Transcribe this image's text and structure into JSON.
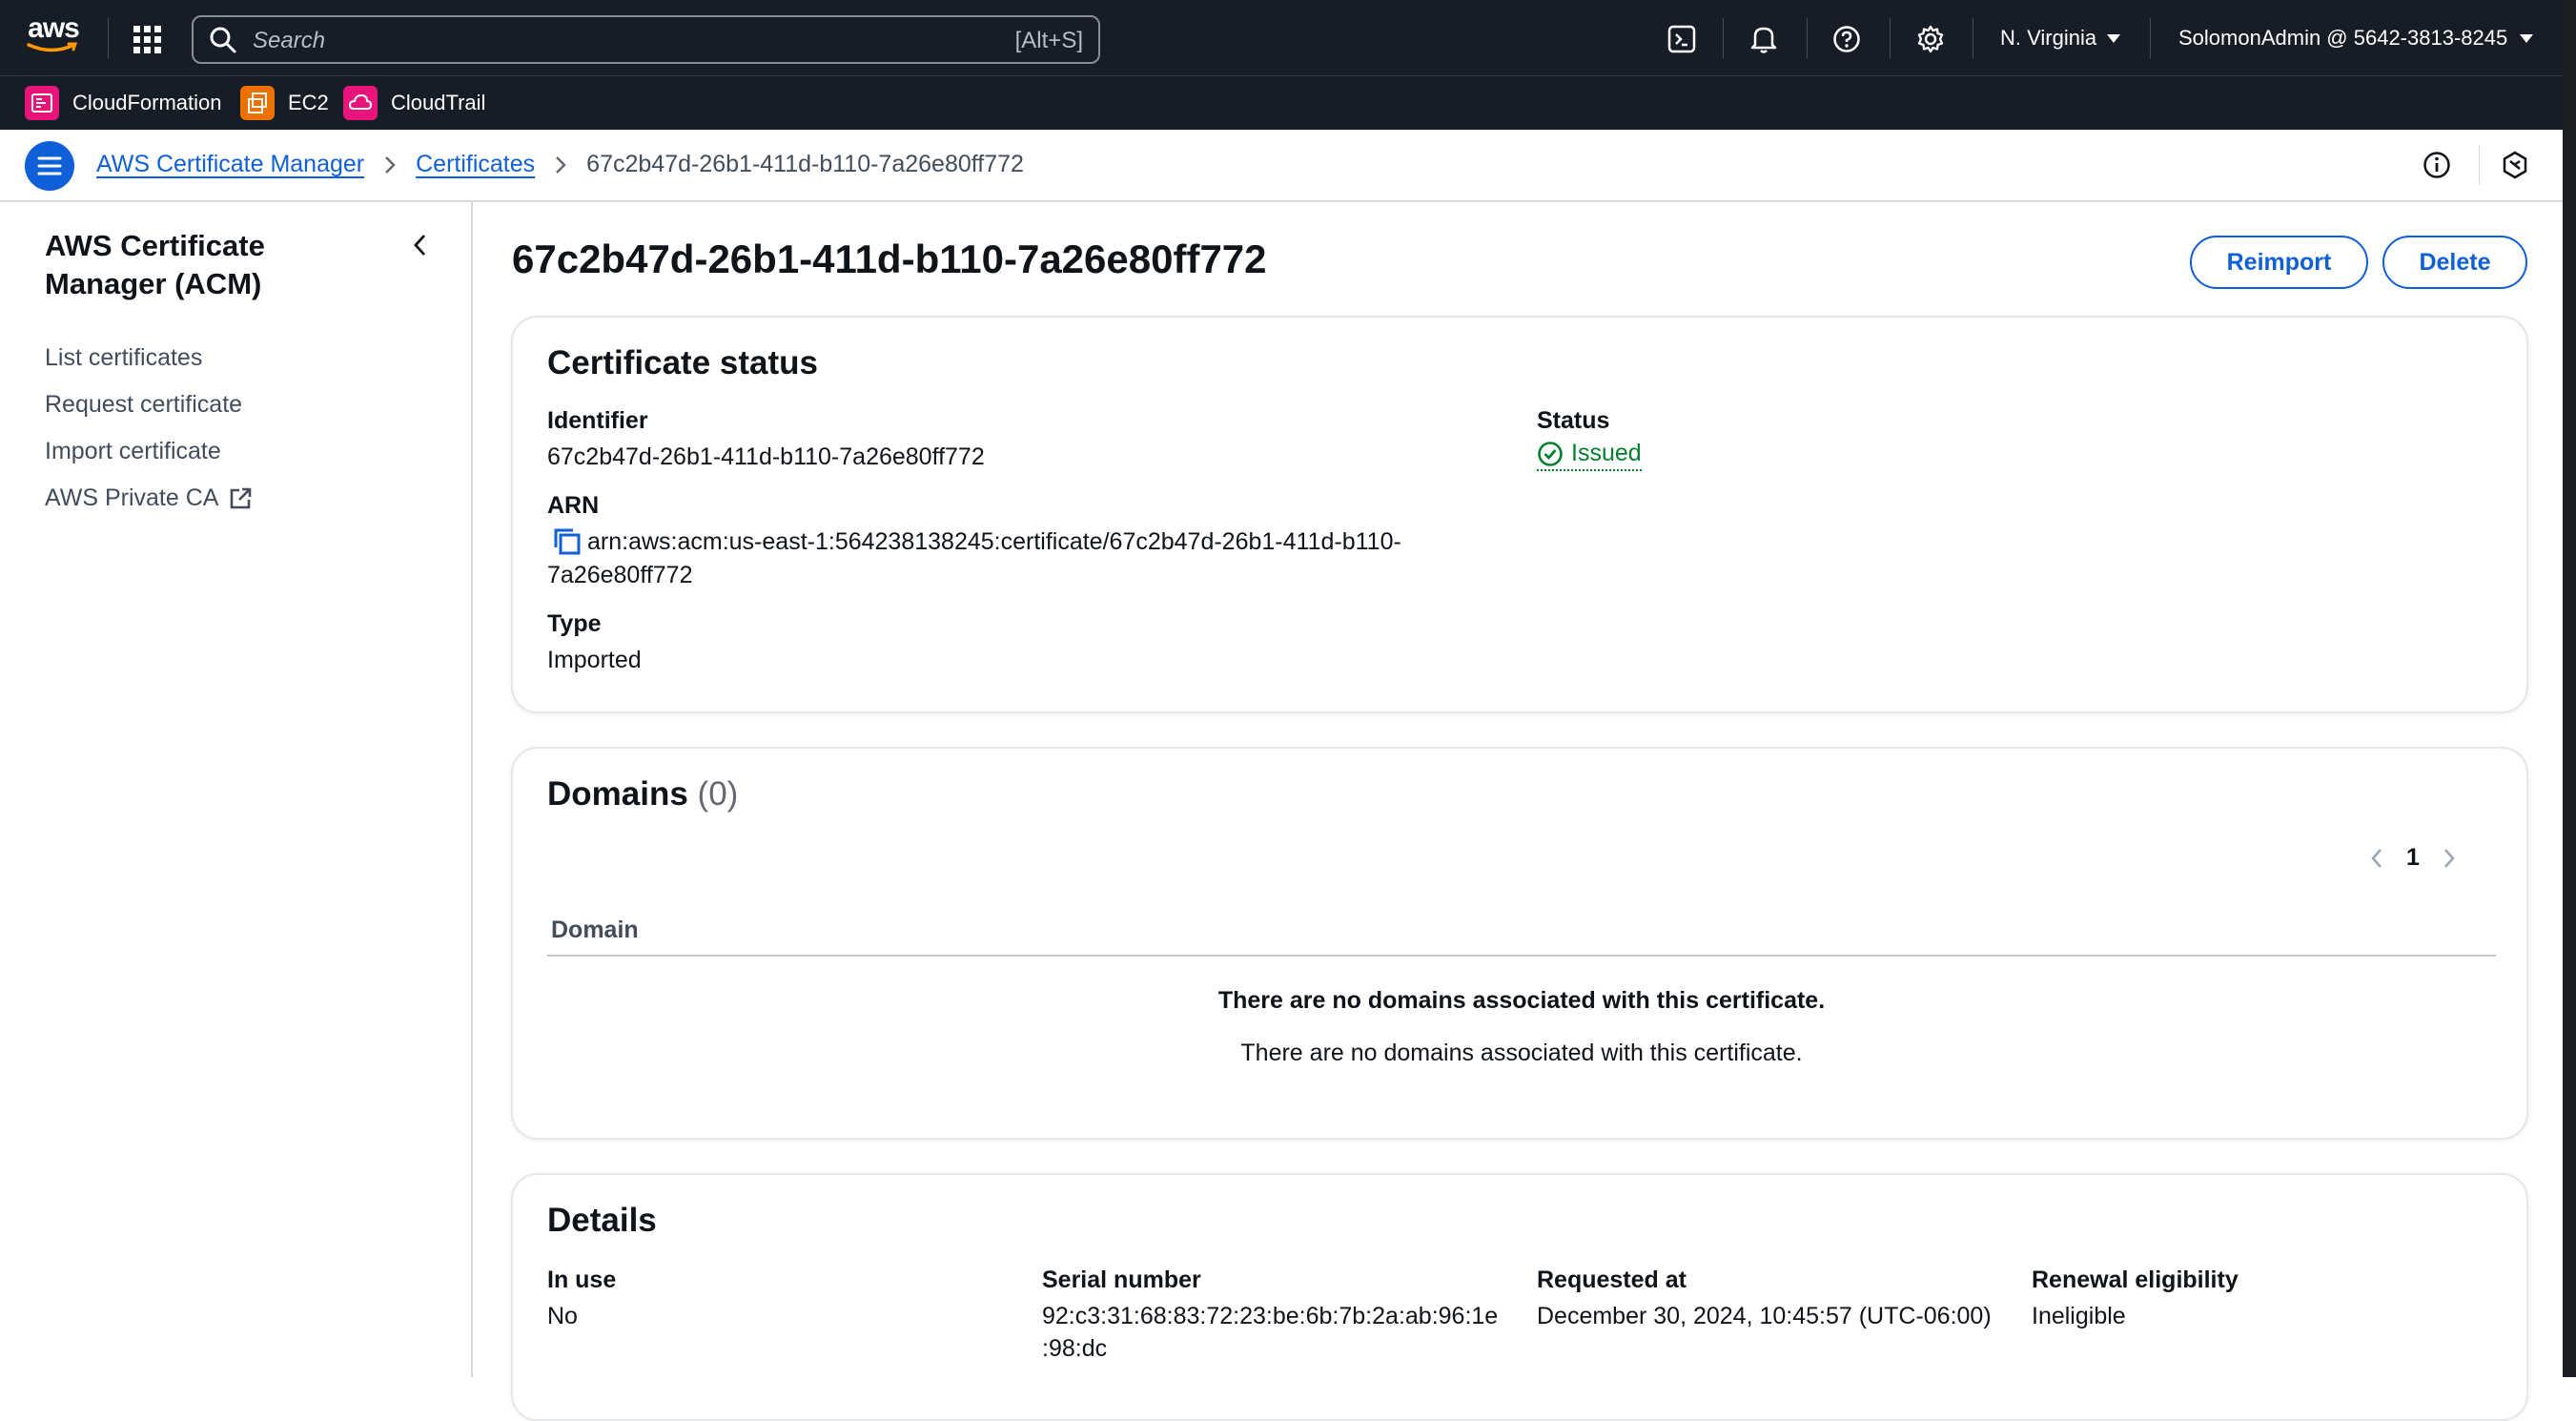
{
  "topnav": {
    "logo": "aws",
    "search_placeholder": "Search",
    "search_shortcut": "[Alt+S]",
    "region": "N. Virginia",
    "account": "SolomonAdmin @ 5642-3813-8245"
  },
  "favorites": [
    {
      "label": "CloudFormation",
      "color": "#e7157b"
    },
    {
      "label": "EC2",
      "color": "#ed7100"
    },
    {
      "label": "CloudTrail",
      "color": "#e7157b"
    }
  ],
  "breadcrumb": {
    "service": "AWS Certificate Manager",
    "section": "Certificates",
    "current": "67c2b47d-26b1-411d-b110-7a26e80ff772"
  },
  "sidenav": {
    "title": "AWS Certificate Manager (ACM)",
    "items": [
      "List certificates",
      "Request certificate",
      "Import certificate",
      "AWS Private CA"
    ]
  },
  "page": {
    "title": "67c2b47d-26b1-411d-b110-7a26e80ff772",
    "reimport_label": "Reimport",
    "delete_label": "Delete"
  },
  "status_card": {
    "title": "Certificate status",
    "identifier_label": "Identifier",
    "identifier": "67c2b47d-26b1-411d-b110-7a26e80ff772",
    "arn_label": "ARN",
    "arn_line1": "arn:aws:acm:us-east-1:564238138245:certificate/67c2b47d-26b1-411d-b110-",
    "arn_line2": "7a26e80ff772",
    "type_label": "Type",
    "type": "Imported",
    "status_label": "Status",
    "status": "Issued",
    "status_color": "#00802f"
  },
  "domains_card": {
    "title": "Domains",
    "count": "(0)",
    "page": "1",
    "column": "Domain",
    "empty_title": "There are no domains associated with this certificate.",
    "empty_text": "There are no domains associated with this certificate."
  },
  "details_card": {
    "title": "Details",
    "in_use_label": "In use",
    "in_use": "No",
    "serial_label": "Serial number",
    "serial_line1": "92:c3:31:68:83:72:23:be:6b:7b:2a:ab:96:1e",
    "serial_line2": ":98:dc",
    "requested_label": "Requested at",
    "requested": "December 30, 2024, 10:45:57 (UTC-06:00)",
    "renewal_label": "Renewal eligibility",
    "renewal": "Ineligible"
  },
  "colors": {
    "nav_bg": "#161d26",
    "link": "#0f5fd9",
    "accent": "#0f5fd9"
  }
}
